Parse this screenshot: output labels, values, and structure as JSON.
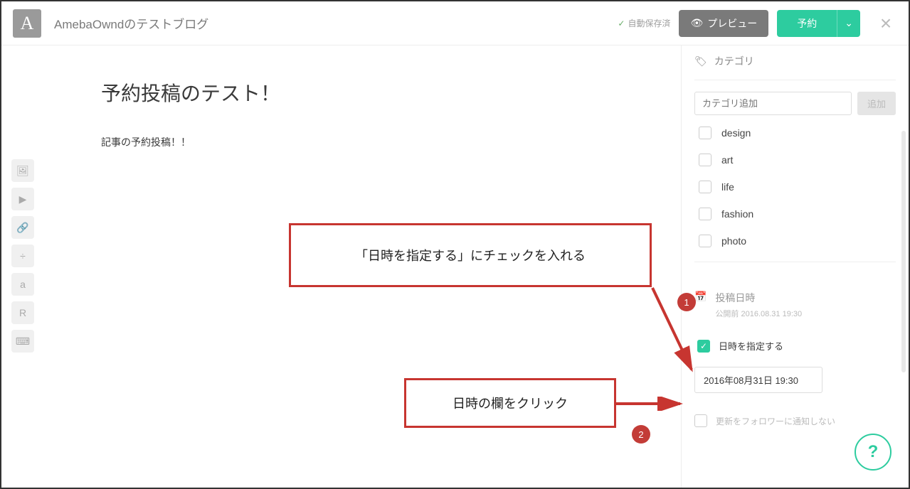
{
  "header": {
    "logo_letter": "A",
    "blog_title": "AmebaOwndのテストブログ",
    "autosave_label": "自動保存済",
    "preview_label": "プレビュー",
    "schedule_label": "予約"
  },
  "post": {
    "title": "予約投稿のテスト！",
    "body": "記事の予約投稿！！"
  },
  "cat_panel": {
    "title": "カテゴリ",
    "input_placeholder": "カテゴリ追加",
    "add_button": "追加",
    "items": [
      "design",
      "art",
      "life",
      "fashion",
      "photo"
    ]
  },
  "date_panel": {
    "title": "投稿日時",
    "subtitle": "公開前 2016.08.31 19:30",
    "toggle_label": "日時を指定する",
    "date_value": "2016年08月31日 19:30",
    "notify_label": "更新をフォロワーに通知しない"
  },
  "annotations": {
    "a1": "「日時を指定する」にチェックを入れる",
    "a2": "日時の欄をクリック",
    "badge1": "1",
    "badge2": "2"
  },
  "tool_icons": [
    "image",
    "video",
    "link",
    "divider",
    "amazon",
    "rakuten",
    "html"
  ]
}
